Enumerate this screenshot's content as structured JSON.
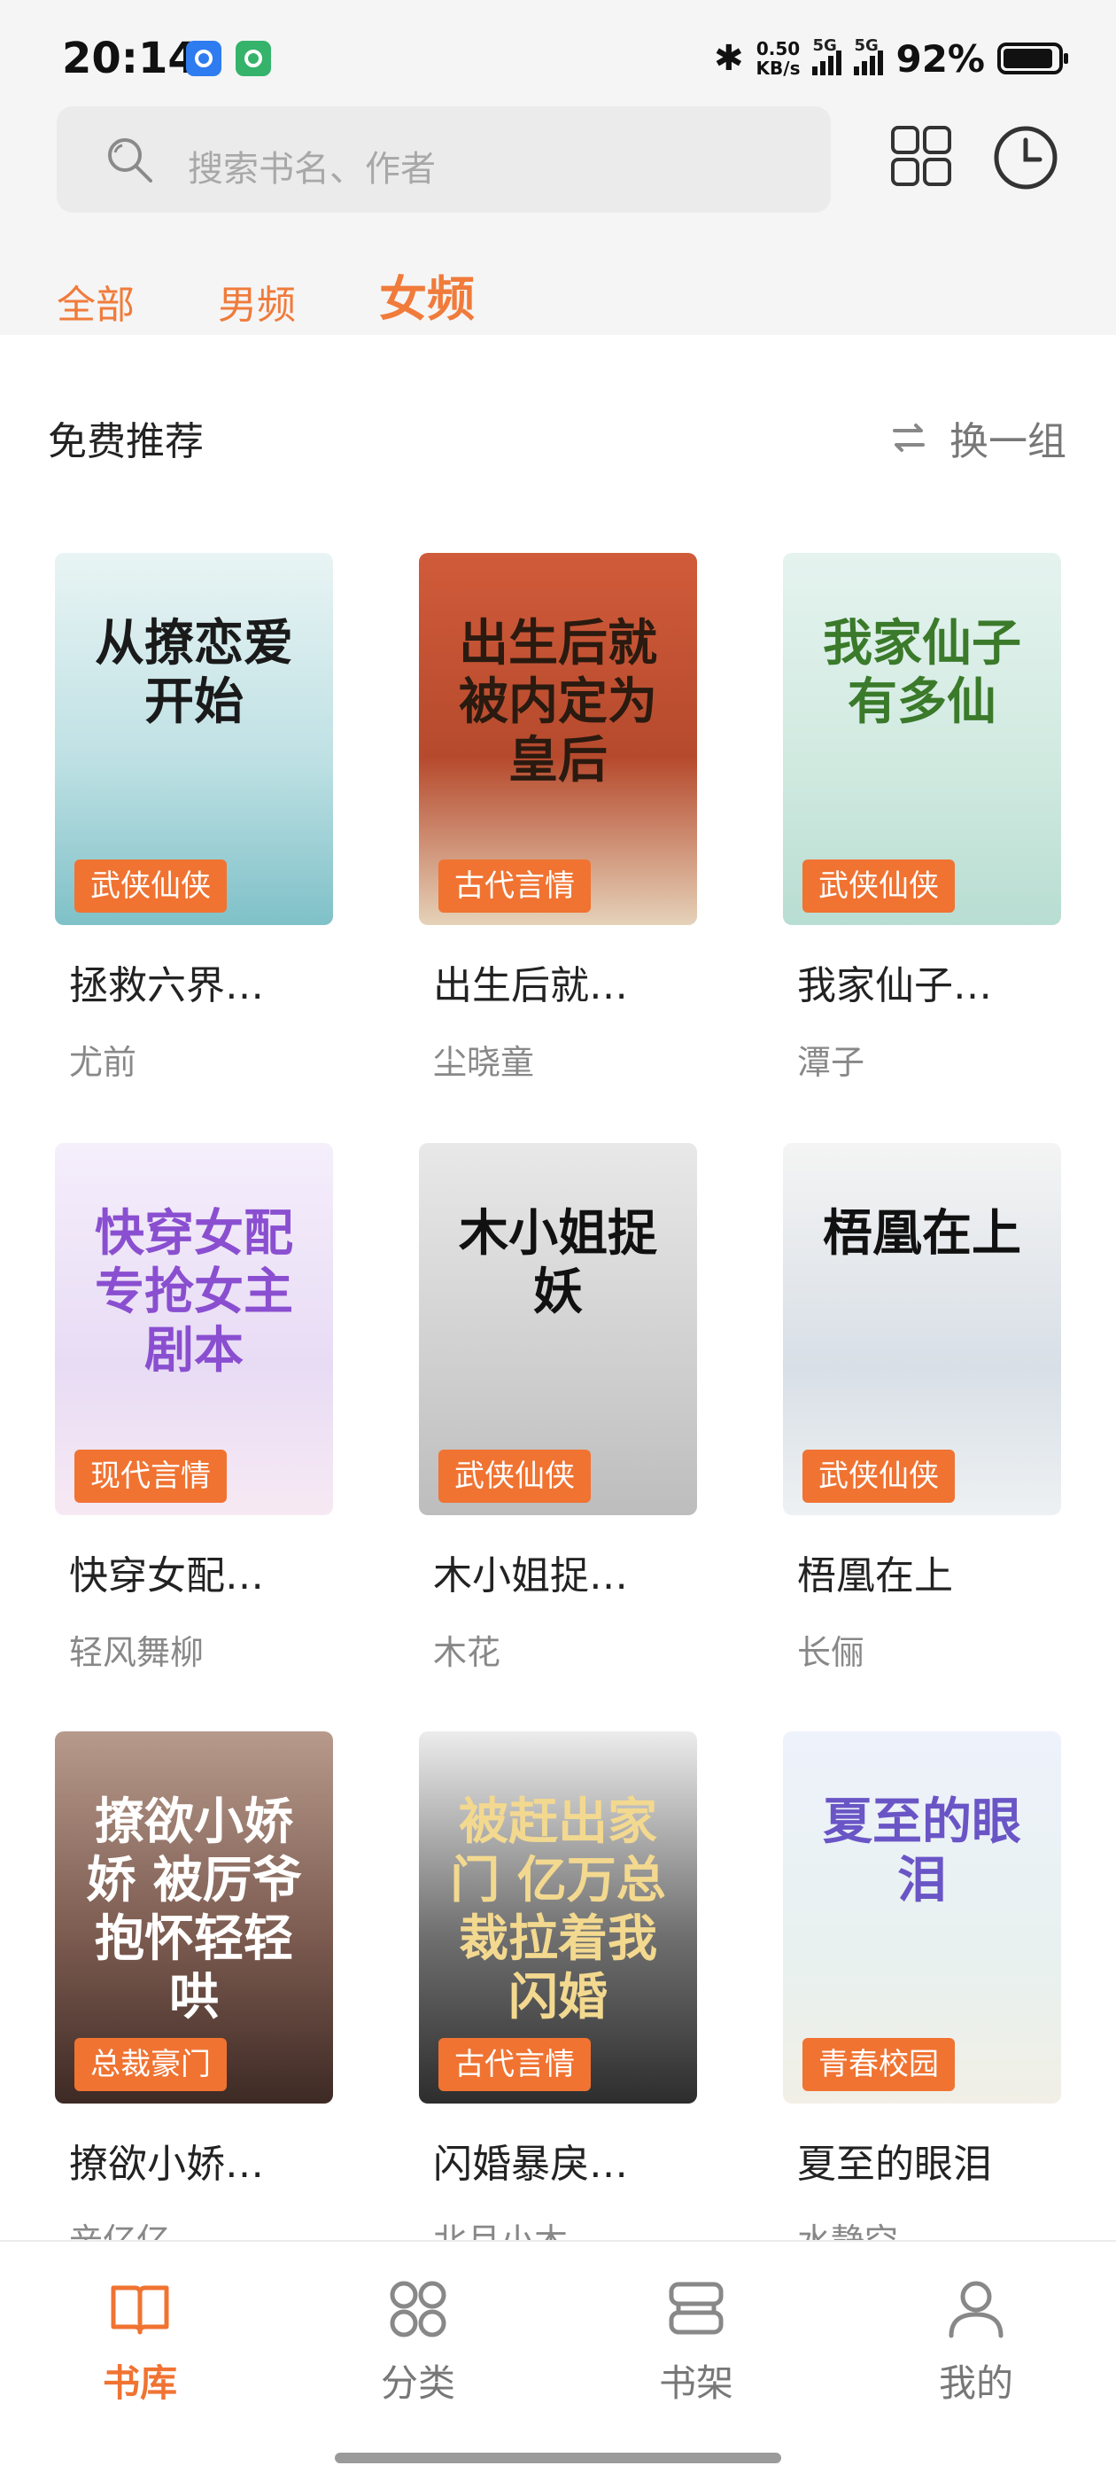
{
  "status_bar": {
    "time": "20:14",
    "net_speed_value": "0.50",
    "net_speed_unit": "KB/s",
    "signal1_label": "5G",
    "signal2_label": "5G",
    "battery_text": "92%",
    "battery_level": 0.92
  },
  "search": {
    "placeholder": "搜索书名、作者"
  },
  "tabs": [
    {
      "label": "全部",
      "active": false
    },
    {
      "label": "男频",
      "active": false
    },
    {
      "label": "女频",
      "active": true
    }
  ],
  "section": {
    "title": "免费推荐",
    "refresh_label": "换一组"
  },
  "books": [
    {
      "cover_text": "从撩恋爱开始",
      "tag": "武侠仙侠",
      "title": "拯救六界…",
      "author": "尤前"
    },
    {
      "cover_text": "出生后就被内定为皇后",
      "tag": "古代言情",
      "title": "出生后就…",
      "author": "尘晓童"
    },
    {
      "cover_text": "我家仙子有多仙",
      "tag": "武侠仙侠",
      "title": "我家仙子…",
      "author": "潭子"
    },
    {
      "cover_text": "快穿女配专抢女主剧本",
      "tag": "现代言情",
      "title": "快穿女配…",
      "author": "轻风舞柳"
    },
    {
      "cover_text": "木小姐捉妖",
      "tag": "武侠仙侠",
      "title": "木小姐捉…",
      "author": "木花"
    },
    {
      "cover_text": "梧凰在上",
      "tag": "武侠仙侠",
      "title": "梧凰在上",
      "author": "长俪"
    },
    {
      "cover_text": "撩欲小娇娇 被厉爷抱怀轻轻哄",
      "tag": "总裁豪门",
      "title": "撩欲小娇…",
      "author": "辛亿亿"
    },
    {
      "cover_text": "被赶出家门 亿万总裁拉着我闪婚",
      "tag": "古代言情",
      "title": "闪婚暴戾…",
      "author": "北月小木"
    },
    {
      "cover_text": "夏至的眼泪",
      "tag": "青春校园",
      "title": "夏至的眼泪",
      "author": "水静空"
    }
  ],
  "bottom_nav": [
    {
      "label": "书库",
      "icon": "book-icon",
      "active": true
    },
    {
      "label": "分类",
      "icon": "category-icon",
      "active": false
    },
    {
      "label": "书架",
      "icon": "bookshelf-icon",
      "active": false
    },
    {
      "label": "我的",
      "icon": "profile-icon",
      "active": false
    }
  ],
  "colors": {
    "accent": "#f07332",
    "tab_text": "#f07b3b",
    "header_bg": "#f5f5f5"
  }
}
